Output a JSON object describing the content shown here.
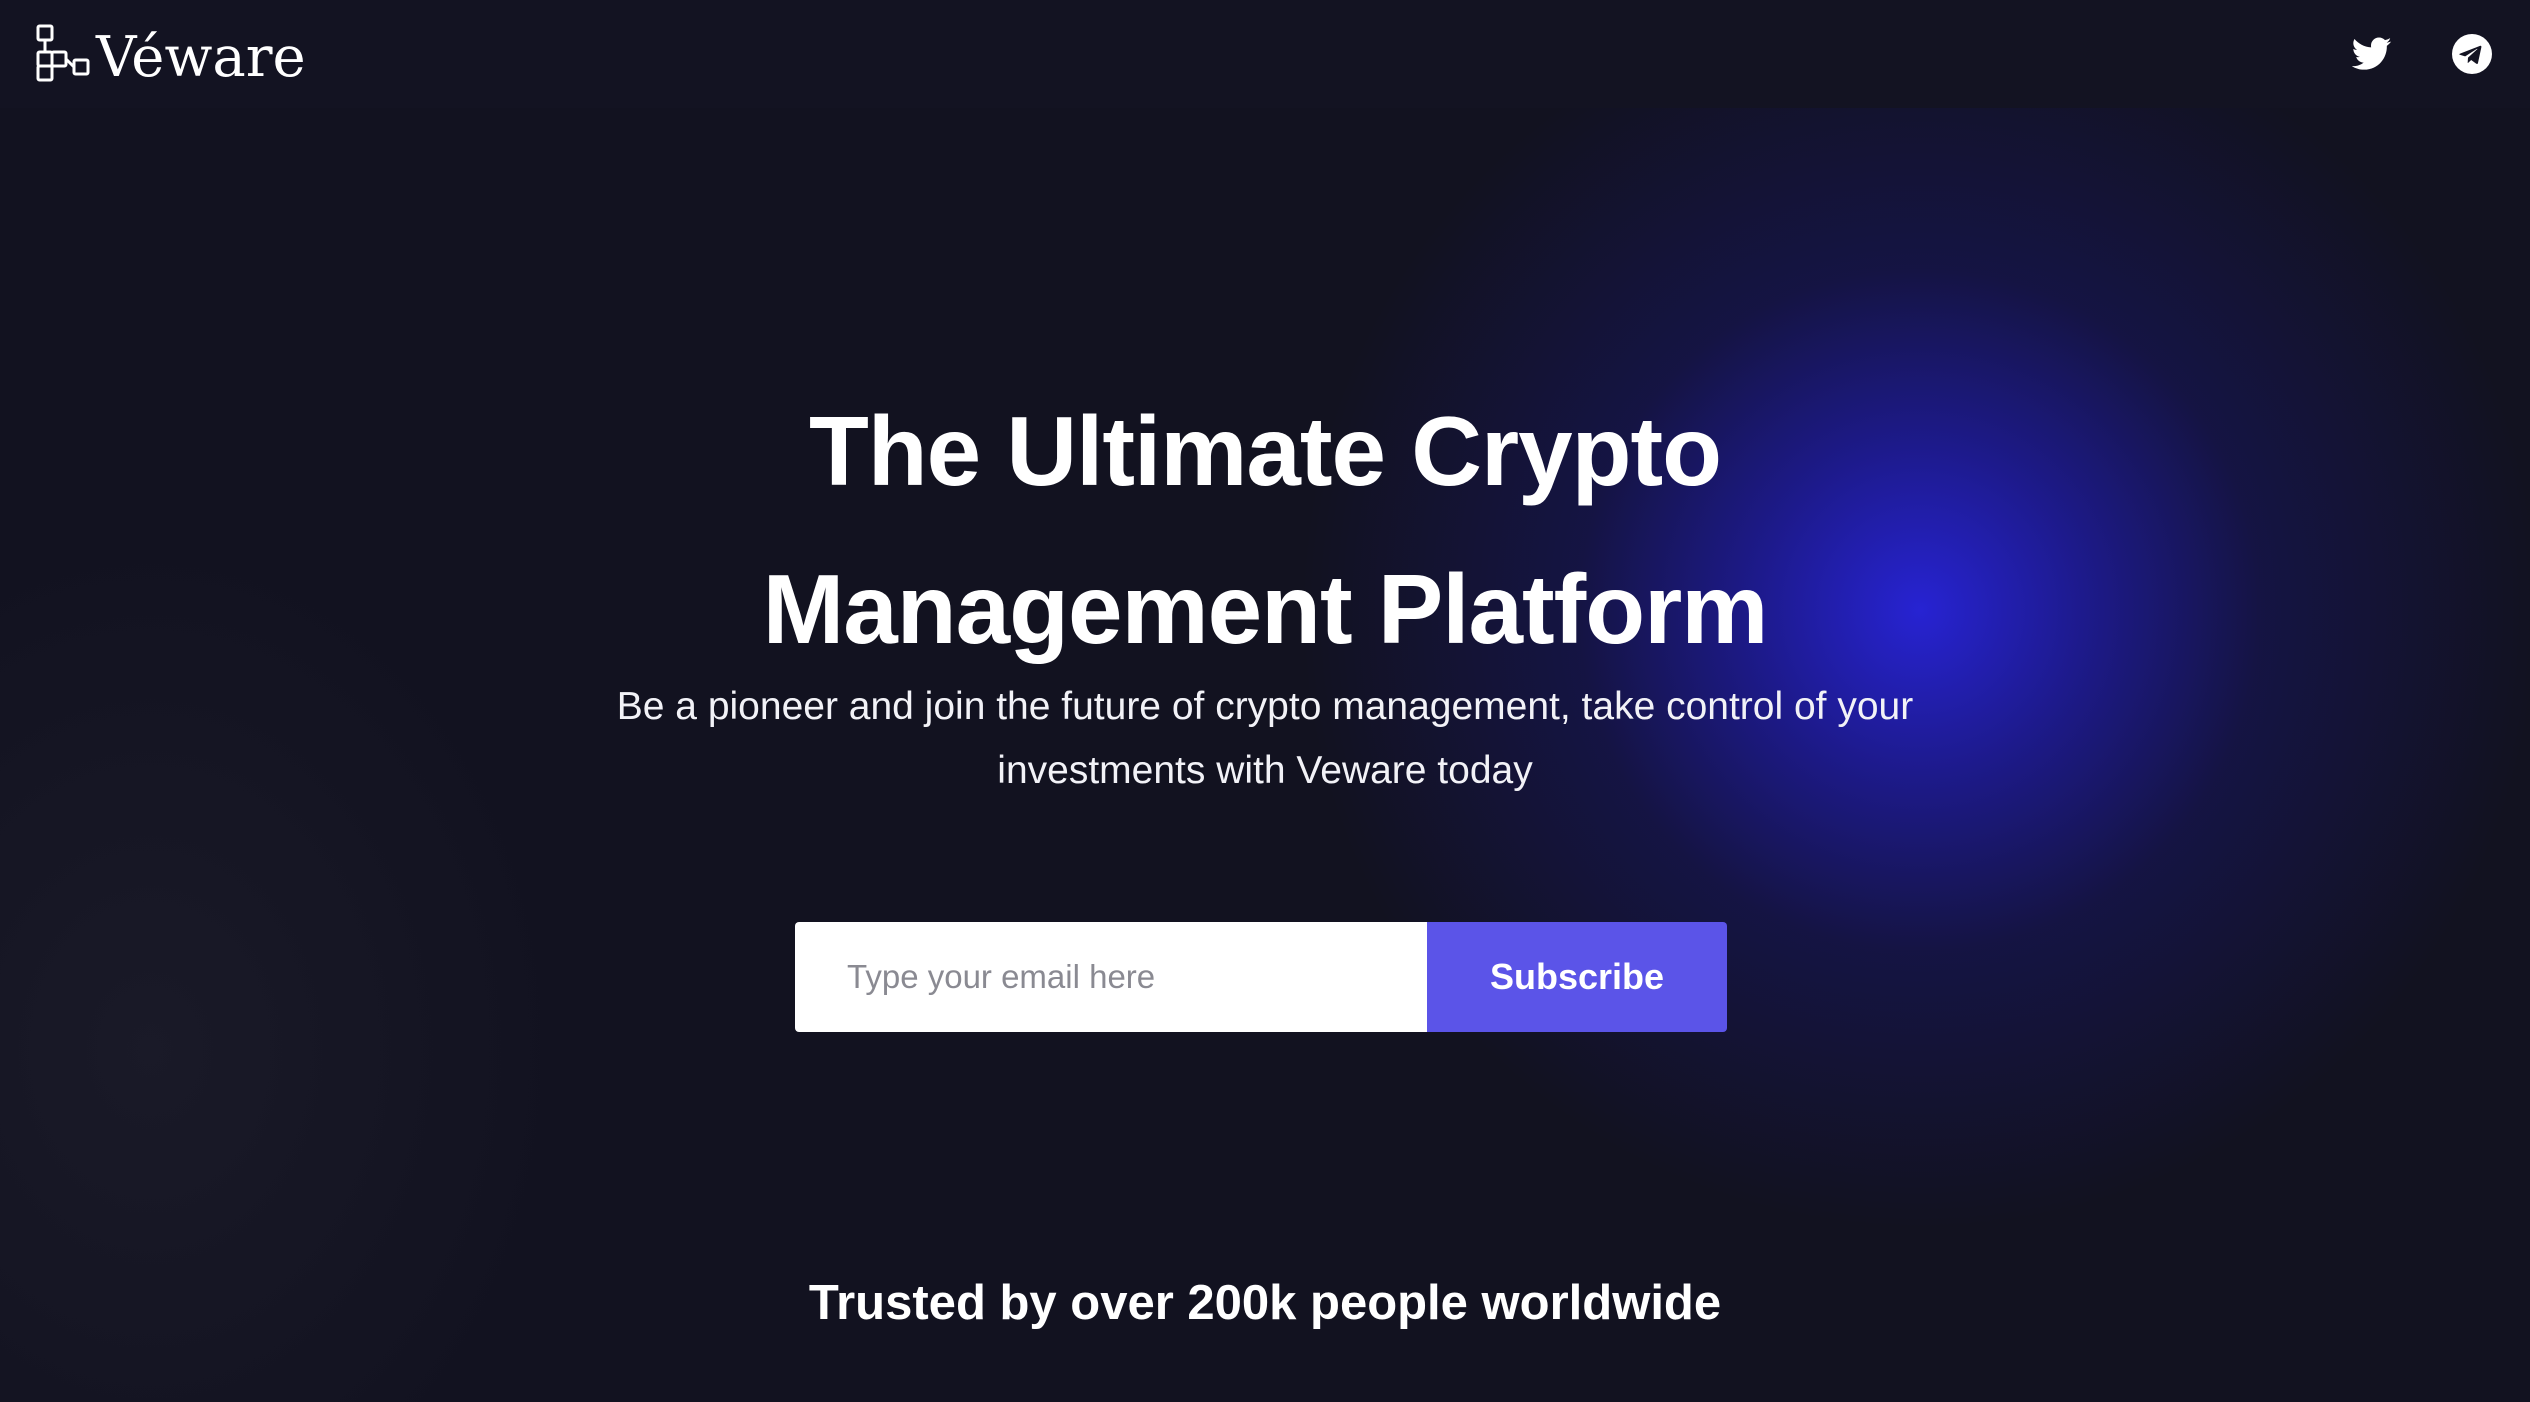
{
  "brand": {
    "name": "Véware",
    "icon": "interlocking-squares-logo"
  },
  "social": {
    "twitter_icon": "twitter-bird-icon",
    "telegram_icon": "telegram-paper-plane-icon"
  },
  "hero": {
    "headline_line1": "The Ultimate Crypto",
    "headline_line2": "Management Platform",
    "subtitle": "Be a pioneer and join the future of crypto management, take control of your investments with Veware today"
  },
  "signup": {
    "email_placeholder": "Type your email here",
    "email_value": "",
    "subscribe_label": "Subscribe"
  },
  "footer": {
    "trusted_text": "Trusted by over 200k people worldwide"
  },
  "colors": {
    "background": "#121220",
    "accent": "#5b54e8",
    "glow": "#2824dc",
    "text": "#ffffff"
  }
}
